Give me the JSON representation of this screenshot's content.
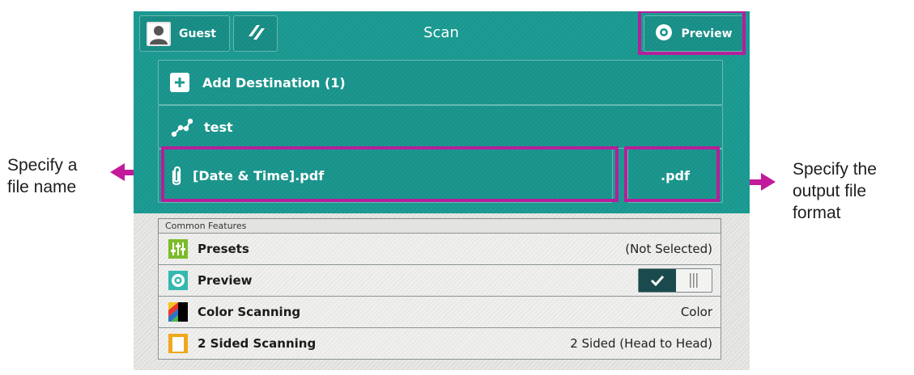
{
  "annotations": {
    "left_text_line1": "Specify a",
    "left_text_line2": "file name",
    "right_text_line1": "Specify the",
    "right_text_line2": "output file",
    "right_text_line3": "format",
    "accent_color": "#c21a9a"
  },
  "header": {
    "user_label": "Guest",
    "title": "Scan",
    "preview_button_label": "Preview"
  },
  "rows": {
    "add_destination_label": "Add Destination (1)",
    "destination_name": "test",
    "file_name": "[Date & Time].pdf",
    "file_format": ".pdf"
  },
  "common_features": {
    "section_title": "Common Features",
    "items": [
      {
        "label": "Presets",
        "value": "(Not Selected)",
        "icon": "presets-icon"
      },
      {
        "label": "Preview",
        "value": "",
        "icon": "preview-eye-icon",
        "toggle_on": true
      },
      {
        "label": "Color Scanning",
        "value": "Color",
        "icon": "color-scanning-icon"
      },
      {
        "label": "2 Sided Scanning",
        "value": "2 Sided (Head to Head)",
        "icon": "two-sided-scanning-icon"
      }
    ]
  },
  "colors": {
    "teal": "#1c9a92",
    "highlight_box": "#b51f9a",
    "toggle_dark": "#1a4a4e"
  }
}
